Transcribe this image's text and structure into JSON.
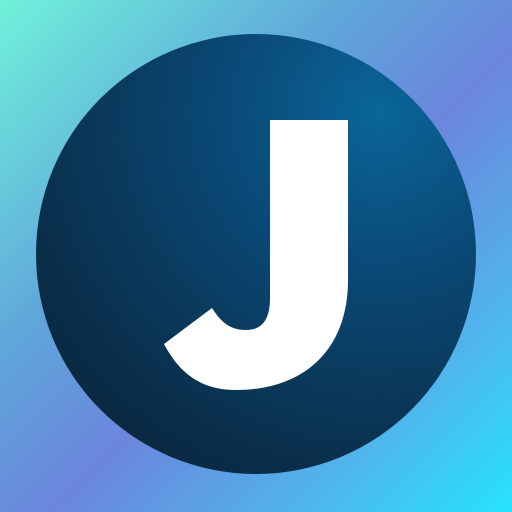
{
  "logo": {
    "letter": "J",
    "colors": {
      "background_start": "#6ff2d9",
      "background_mid": "#6b86dc",
      "background_end": "#26e3fb",
      "circle_light": "#0a6699",
      "circle_dark": "#0a1d2f",
      "letter": "#ffffff"
    }
  }
}
